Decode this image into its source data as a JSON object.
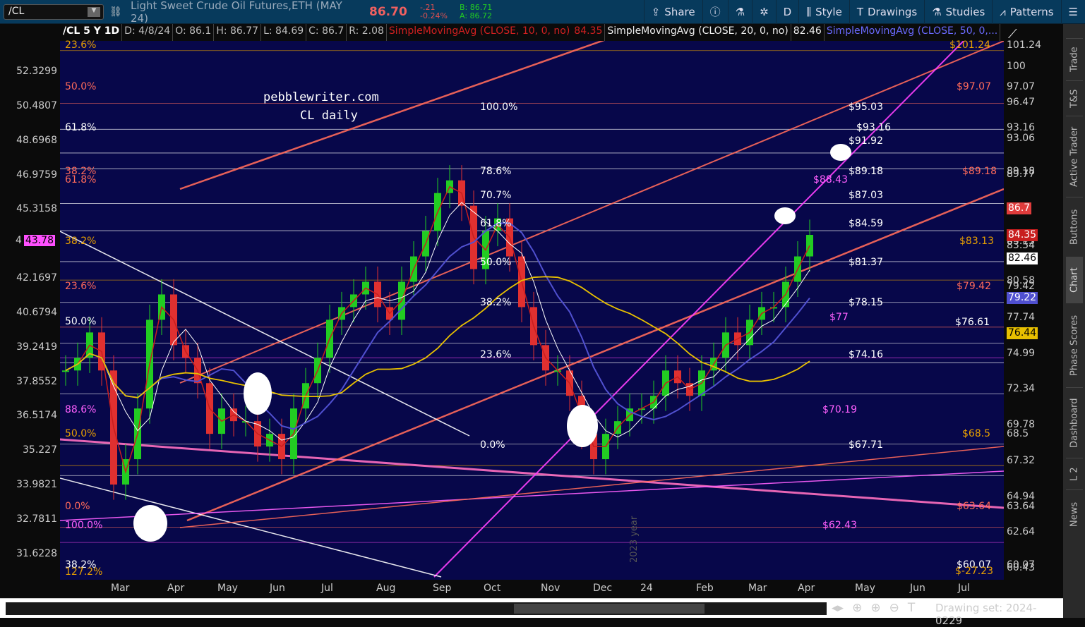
{
  "toolbar": {
    "symbol": "/CL",
    "description": "Light Sweet Crude Oil Futures,ETH (MAY 24)",
    "last": "86.70",
    "change": "-.21",
    "change_pct": "-0.24%",
    "bid": "B: 86.71",
    "ask": "A: 86.72",
    "buttons": [
      {
        "label": "Share",
        "icon": "share-icon"
      },
      {
        "label": "",
        "icon": "info-icon"
      },
      {
        "label": "",
        "icon": "flask-icon"
      },
      {
        "label": "",
        "icon": "gear-icon"
      },
      {
        "label": "D",
        "icon": ""
      },
      {
        "label": "Style",
        "icon": "candle-icon"
      },
      {
        "label": "Drawings",
        "icon": "text-icon"
      },
      {
        "label": "Studies",
        "icon": "flask-icon"
      },
      {
        "label": "Patterns",
        "icon": "pattern-icon"
      },
      {
        "label": "",
        "icon": "menu-icon"
      }
    ]
  },
  "header": {
    "symbol": "/CL 5 Y 1D",
    "date": "D: 4/8/24",
    "open": "O: 86.1",
    "high": "H: 86.77",
    "low": "L: 84.69",
    "close": "C: 86.7",
    "range": "R: 2.08",
    "sma10": "SimpleMovingAvg (CLOSE, 10, 0, no)",
    "sma10_val": "84.35",
    "sma20": "SimpleMovingAvg (CLOSE, 20, 0, no)",
    "sma20_val": "82.46",
    "sma50": "SimpleMovingAvg (CLOSE, 50, 0,..."
  },
  "watermark": {
    "line1": "pebblewriter.com",
    "line2": "CL daily",
    "year": "2023 year"
  },
  "right_axis": [
    "101.24",
    "100",
    "97.07",
    "96.47",
    "93.16",
    "93.06",
    "89.77",
    "89.18",
    "83.54",
    "83.13",
    "80.58",
    "79.42",
    "77.74",
    "74.99",
    "72.34",
    "69.78",
    "68.5",
    "67.32",
    "64.94",
    "63.64",
    "62.64",
    "60.43",
    "60.07"
  ],
  "right_badges": [
    {
      "text": "86.7",
      "color": "#e03c3c"
    },
    {
      "text": "84.35",
      "color": "#c81e1e"
    },
    {
      "text": "82.46",
      "color": "#ffffff"
    },
    {
      "text": "79.22",
      "color": "#5050d0"
    },
    {
      "text": "76.44",
      "color": "#e8c000"
    }
  ],
  "left_axis": [
    "52.3299",
    "50.4807",
    "48.6968",
    "46.9759",
    "45.3158",
    "42.1697",
    "40.6794",
    "39.2419",
    "37.8552",
    "36.5174",
    "35.227",
    "33.9821",
    "32.7811",
    "31.6228"
  ],
  "left_badge": {
    "prefix": "4",
    "text": "43.78"
  },
  "fib_left": [
    "23.6%",
    "50.0%",
    "61.8%",
    "38.2%",
    "61.8%",
    "38.2%",
    "23.6%",
    "50.0%",
    "88.6%",
    "50.0%",
    "0.0%",
    "100.0%",
    "38.2%",
    "127.2%"
  ],
  "fib_mid": [
    {
      "pct": "100.0%",
      "price": "$95.03"
    },
    {
      "pct": "78.6%",
      "price": "$89.18"
    },
    {
      "pct": "70.7%",
      "price": "$87.03"
    },
    {
      "pct": "61.8%",
      "price": "$84.59"
    },
    {
      "pct": "50.0%",
      "price": "$81.37"
    },
    {
      "pct": "38.2%",
      "price": "$78.15"
    },
    {
      "pct": "23.6%",
      "price": "$74.16"
    },
    {
      "pct": "0.0%",
      "price": "$67.71"
    }
  ],
  "price_labels": [
    "$101.24",
    "$97.07",
    "$93.16",
    "$91.92",
    "$89.18",
    "$88.43",
    "$83.13",
    "$79.42",
    "$77",
    "$76.61",
    "$70.19",
    "$68.5",
    "$63.64",
    "$62.43",
    "$60.07",
    "$-27.23"
  ],
  "sidebar": [
    "Trade",
    "T&S",
    "Active Trader",
    "Buttons",
    "Chart",
    "Phase Scores",
    "Dashboard",
    "L 2",
    "News"
  ],
  "footer": {
    "drawing_set": "Drawing set: 2024-0229"
  },
  "colors": {
    "background": "#07074a",
    "up": "#22cc22",
    "down": "#e03030",
    "sma10": "#c81e1e",
    "sma20": "#ffffff",
    "sma50": "#5050d0",
    "sma200": "#e8c000",
    "fib": "#ff6a5a"
  },
  "chart_data": {
    "type": "candlestick",
    "title": "/CL 5 Y 1D",
    "x_labels": [
      "Mar",
      "Apr",
      "May",
      "Jun",
      "Jul",
      "Aug",
      "Sep",
      "Oct",
      "Nov",
      "Dec",
      "24",
      "Feb",
      "Mar",
      "Apr",
      "May",
      "Jun",
      "Jul"
    ],
    "ylim": [
      59.5,
      102.2
    ],
    "weekly_close_approx": [
      76,
      77,
      79,
      76,
      67,
      69,
      73,
      80,
      82,
      78,
      77,
      75,
      71,
      73,
      72,
      72,
      70,
      71,
      69,
      73,
      75,
      77,
      80,
      81,
      82,
      83,
      81,
      80,
      83,
      85,
      87,
      90,
      91,
      89,
      84,
      87,
      88,
      85,
      81,
      78,
      76,
      76,
      74,
      71,
      69,
      71,
      72,
      73,
      73,
      74,
      76,
      75,
      74,
      76,
      77,
      79,
      78,
      80,
      81,
      81,
      83,
      85,
      86.7
    ]
  }
}
